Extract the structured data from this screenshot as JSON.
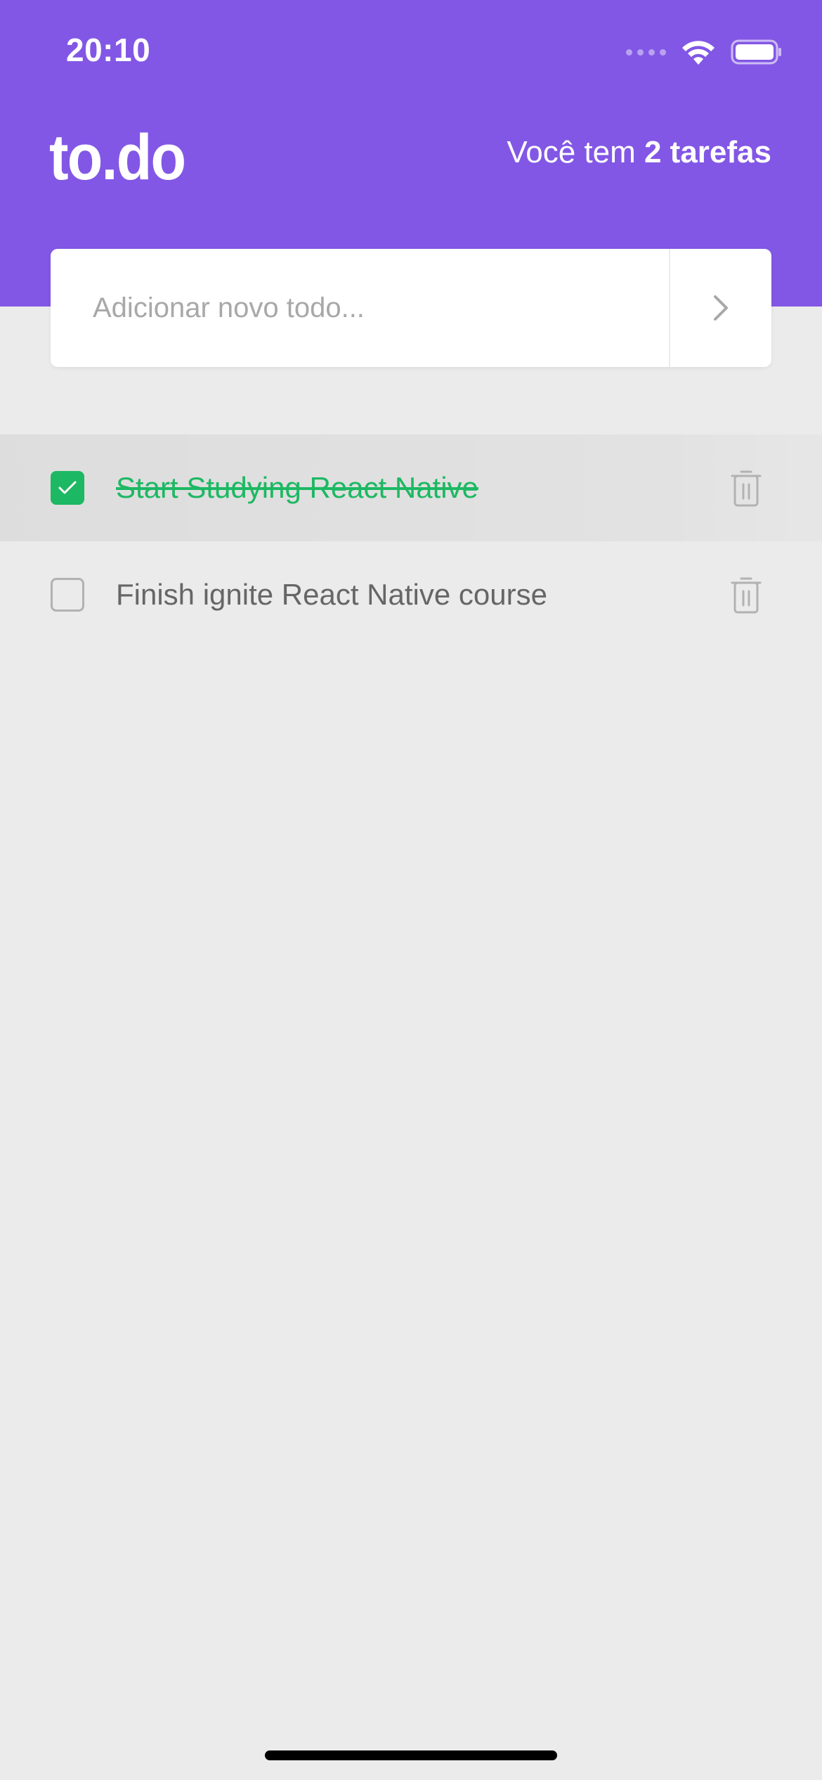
{
  "status_bar": {
    "time": "20:10"
  },
  "header": {
    "logo": "to.do",
    "summary_prefix": "Você tem ",
    "summary_count": "2 tarefas"
  },
  "new_todo": {
    "placeholder": "Adicionar novo todo...",
    "value": ""
  },
  "todos": [
    {
      "title": "Start Studying React Native",
      "done": true
    },
    {
      "title": "Finish ignite React Native course",
      "done": false
    }
  ],
  "colors": {
    "brand": "#8257e5",
    "done": "#1db863",
    "text": "#666666",
    "background": "#ebebeb"
  },
  "icons": {
    "submit": "chevron-right-icon",
    "delete": "trash-icon",
    "check": "check-icon",
    "wifi": "wifi-icon",
    "battery": "battery-icon",
    "signal": "signal-icon"
  }
}
